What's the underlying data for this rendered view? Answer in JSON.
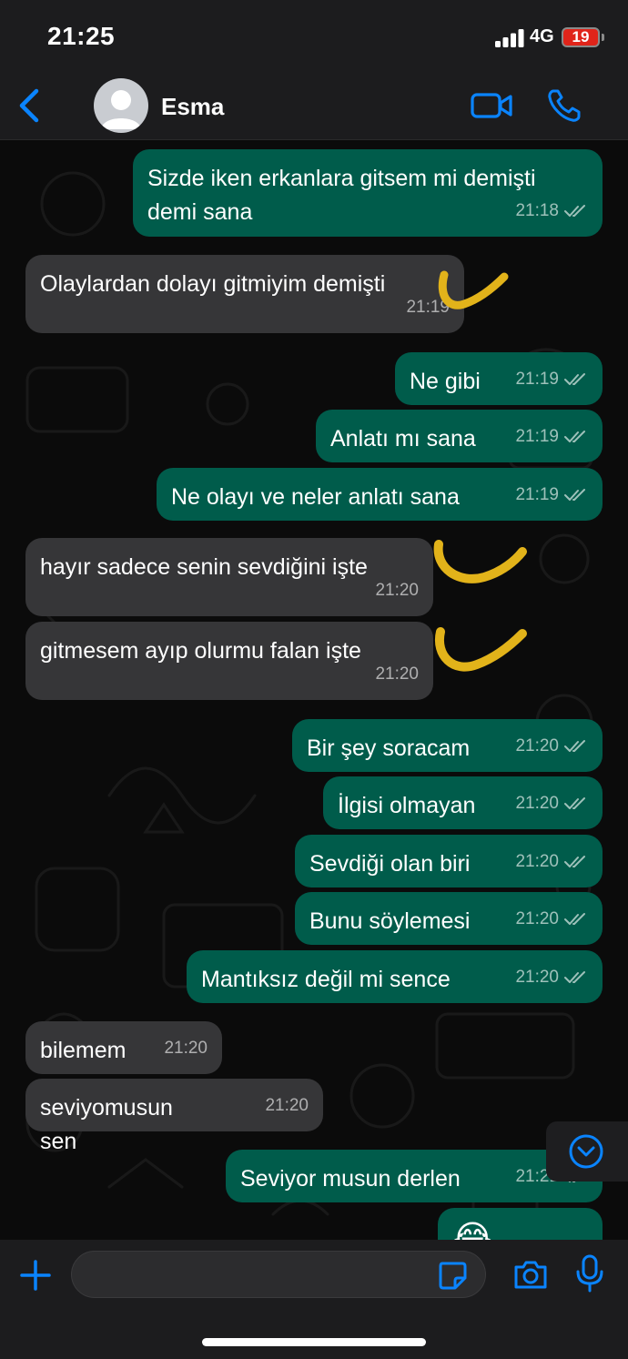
{
  "status_bar": {
    "time": "21:25",
    "network": "4G",
    "battery": "19"
  },
  "header": {
    "contact_name": "Esma"
  },
  "messages": [
    {
      "dir": "out",
      "text": "Sizde iken erkanlara gitsem mi demişti demi sana",
      "time": "21:18"
    },
    {
      "dir": "in",
      "text": "Olaylardan dolayı gitmiyim demişti",
      "time": "21:19"
    },
    {
      "dir": "out",
      "text": "Ne gibi",
      "time": "21:19"
    },
    {
      "dir": "out",
      "text": "Anlatı mı sana",
      "time": "21:19"
    },
    {
      "dir": "out",
      "text": "Ne olayı ve neler anlatı sana",
      "time": "21:19"
    },
    {
      "dir": "in",
      "text": "hayır sadece senin sevdiğini işte",
      "time": "21:20"
    },
    {
      "dir": "in",
      "text": "gitmesem ayıp olurmu falan işte",
      "time": "21:20"
    },
    {
      "dir": "out",
      "text": "Bir şey soracam",
      "time": "21:20"
    },
    {
      "dir": "out",
      "text": "İlgisi olmayan",
      "time": "21:20"
    },
    {
      "dir": "out",
      "text": "Sevdiği olan biri",
      "time": "21:20"
    },
    {
      "dir": "out",
      "text": "Bunu söylemesi",
      "time": "21:20"
    },
    {
      "dir": "out",
      "text": "Mantıksız değil mi sence",
      "time": "21:20"
    },
    {
      "dir": "in",
      "text": "bilemem",
      "time": "21:20"
    },
    {
      "dir": "in",
      "text": "seviyomusun sen",
      "time": "21:20"
    },
    {
      "dir": "out",
      "text": "Seviyor musun derlen",
      "time": "21:21"
    },
    {
      "dir": "out",
      "text": "😂😂😂",
      "time": ""
    }
  ],
  "composer": {
    "placeholder": ""
  },
  "icons": {
    "back": "chevron-left-icon",
    "video": "video-call-icon",
    "phone": "phone-icon",
    "plus": "plus-icon",
    "sticker": "sticker-icon",
    "camera": "camera-icon",
    "mic": "microphone-icon",
    "scroll": "scroll-down-icon",
    "read": "double-check-icon",
    "scribble": "yellow-checkmark-annotation"
  },
  "colors": {
    "accent": "#0a84ff",
    "outgoing": "#005c4b",
    "incoming": "#363638",
    "battery_low": "#e0241a",
    "annotation": "#e2b31a"
  }
}
